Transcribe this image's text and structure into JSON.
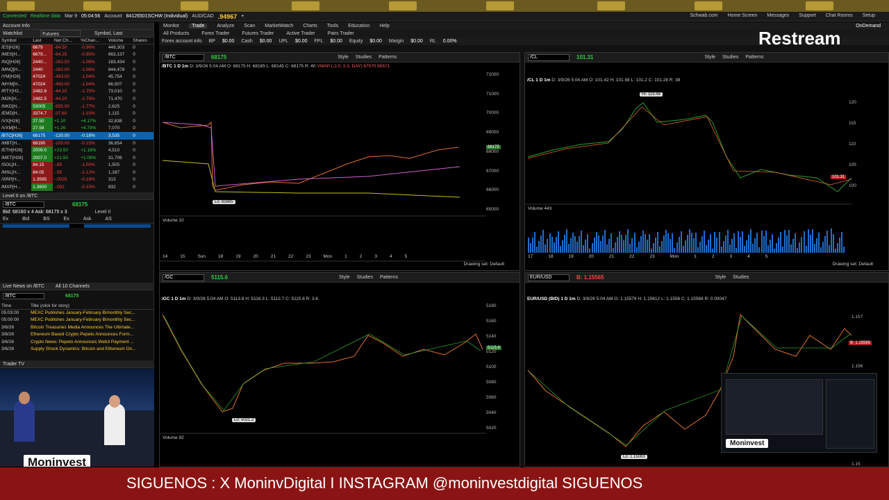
{
  "topbar": {
    "status": "Connected",
    "data": "Realtime data",
    "date": "Mar 9",
    "time": "05:04:56",
    "account_label": "Account",
    "account": "84126501SCHW (Individual)",
    "pair": "AUD/CAD",
    "pair_price": ".94967",
    "links": [
      "Schwab.com",
      "Home Screen",
      "Messages",
      "Support",
      "Chat Rooms",
      "Setup"
    ]
  },
  "left": {
    "account_info": "Account Info",
    "watchlist": "Watchlist",
    "futures": "Futures",
    "symbol_last": "Symbol, Last",
    "columns": [
      "Symbol",
      "Last",
      "Net Ch...",
      "%Chan...",
      "Volume",
      "Shares"
    ],
    "rows": [
      [
        "/ES[H26]",
        "6679",
        "-64.50",
        "-0.96%",
        "449,303",
        "0",
        "dn"
      ],
      [
        "/MES[H...",
        "6679...",
        "-64.25",
        "-0.95%",
        "663,137",
        "0",
        "dn"
      ],
      [
        "/NQ[H26]",
        "2440...",
        "-262.50",
        "-1.06%",
        "183,434",
        "0",
        "dn"
      ],
      [
        "/MNQ[H...",
        "2440",
        "-262.00",
        "-1.06%",
        "844,478",
        "0",
        "dn"
      ],
      [
        "/YM[H26]",
        "47024",
        "-493.00",
        "-1.04%",
        "45,754",
        "0",
        "dn"
      ],
      [
        "/MYM[H...",
        "47024",
        "-493.00",
        "-1.04%",
        "66,907",
        "0",
        "dn"
      ],
      [
        "/RTY[H2...",
        "2482.6",
        "-44.10",
        "-1.75%",
        "73,010",
        "0",
        "dn"
      ],
      [
        "/M2K[H...",
        "2482.5",
        "-44.20",
        "-1.75%",
        "71,470",
        "0",
        "dn"
      ],
      [
        "/NKD[H...",
        "53005",
        "-955.00",
        "-1.77%",
        "2,625",
        "0",
        "up"
      ],
      [
        "/EMD[H...",
        "3374.7",
        "-37.60",
        "-1.10%",
        "1,115",
        "0",
        "dn"
      ],
      [
        "/VX[H26]",
        "27.50",
        "+1.10",
        "+4.17%",
        "32,838",
        "0",
        "up"
      ],
      [
        "/VXM[H...",
        "27.58",
        "+1.26",
        "+4.79%",
        "7,070",
        "0",
        "up"
      ],
      [
        "/BTC[H26]",
        "68175",
        "-120.00",
        "-0.18%",
        "3,535",
        "0",
        "sel"
      ],
      [
        "/MBT[H...",
        "68190",
        "-105.00",
        "-0.15%",
        "36,654",
        "0",
        "dn"
      ],
      [
        "/ETH[H26]",
        "2009.0",
        "+23.50",
        "+1.18%",
        "4,510",
        "0",
        "up"
      ],
      [
        "/MET[H26]",
        "2007.0",
        "+21.50",
        "+1.08%",
        "31,706",
        "0",
        "up"
      ],
      [
        "/SOL[H...",
        "84.15",
        "-.85",
        "-1.00%",
        "1,505",
        "0",
        "dn"
      ],
      [
        "/MSL[H...",
        "84.05",
        "-.95",
        "-1.12%",
        "1,187",
        "0",
        "dn"
      ],
      [
        "/XRP[H...",
        "1.3595",
        "-.0025",
        "-0.18%",
        "313",
        "0",
        "dn"
      ],
      [
        "/MXP[H...",
        "1.3600",
        "-.002",
        "-0.15%",
        "832",
        "0",
        "up"
      ]
    ],
    "level2_title": "Level II on /BTC",
    "level2_sym": "/BTC",
    "level2_price": "68175",
    "bid_ask": "Bid: 68160 x 4   Ask: 68175 x 3",
    "level2_cols": [
      "Ex",
      "Bid",
      "BS",
      "Ex",
      "Ask",
      "AS"
    ],
    "level2_label": "Level II",
    "news_title": "Live News on /BTC",
    "news_channels": "All 10 Channels",
    "news_sym": "/BTC",
    "news_price": "68175",
    "news_cols": [
      "Time",
      "Title (click for story)"
    ],
    "news": [
      [
        "05:03:00",
        "MEXC Publishes January-February Bimonthly Sec..."
      ],
      [
        "05:00:00",
        "MEXC Publishes January-February Bimonthly Sec..."
      ],
      [
        "3/6/26",
        "Bitcoin Treasuries Media Announces The Ultimate..."
      ],
      [
        "3/6/26",
        "Ethereum Based Crypto Pepeto Announces Form..."
      ],
      [
        "3/6/26",
        "Crypto News: Pepeto Announces Web3 Payment ..."
      ],
      [
        "3/6/26",
        "Supply Shock Dynamics: Bitcoin and Ethereum On..."
      ]
    ],
    "trader_tv": "Trader TV",
    "moninvest": "Moninvest"
  },
  "main": {
    "nav": [
      "Monitor",
      "Trade",
      "Analyze",
      "Scan",
      "MarketWatch",
      "Charts",
      "Tools",
      "Education",
      "Help"
    ],
    "subtabs": [
      "All Products",
      "Forex Trader",
      "Futures Trader",
      "Active Trader",
      "Pairs Trader"
    ],
    "account_items": [
      "Forex account info",
      "BP",
      "$0.00",
      "Cash",
      "$0.00",
      "UPL",
      "$0.00",
      "FPL",
      "$0.00",
      "Equity",
      "$0.00",
      "Margin",
      "$0.00",
      "RL",
      "0.00%"
    ],
    "ondemand": "OnDemand"
  },
  "charts": {
    "btc": {
      "sym": "/BTC",
      "price": "68175",
      "head": "/BTC 1 D 1m",
      "info": "D: 3/9/26 5:04 AM  O: 68175  H: 68185  L: 68145  C: 68175  R: 40",
      "study": "VWAP (-2.0, 2.0, DAY)  67070   65571",
      "low": "Lo: 65685",
      "volume": "Volume 10",
      "axis": [
        "72000",
        "71000",
        "70000",
        "69000",
        "68000",
        "67000",
        "66000",
        "65000"
      ],
      "vaxis": [
        "400",
        "200"
      ],
      "xaxis": [
        "14",
        "15",
        "Sun",
        "18",
        "19",
        "20",
        "21",
        "22",
        "23",
        "Mon",
        "1",
        "2",
        "3",
        "4",
        "5"
      ]
    },
    "cl": {
      "sym": "/CL",
      "price": "101.31",
      "head": "/CL 1 D 1m",
      "info": "D: 3/9/26 5:04 AM  O: 101.42  H: 101.58  L: 101.2  C: 101.28  R: 38",
      "high": "Hi: 119.48",
      "volume": "Volume 443",
      "axis": [
        "120",
        "115",
        "110",
        "105",
        "100"
      ],
      "vaxis": [
        "2,000",
        "1,000"
      ],
      "xaxis": [
        "17",
        "18",
        "19",
        "20",
        "21",
        "22",
        "23",
        "Mon",
        "1",
        "2",
        "3",
        "4",
        "5"
      ]
    },
    "gc": {
      "sym": "/GC",
      "price": "5115.6",
      "head": "/GC 1 D 1m",
      "info": "D: 3/9/26 5:04 AM  O: 5113.8  H: 5116.3  L: 5112.7  C: 5115.6  R: 3.6",
      "low": "Lo: 5021.2",
      "volume": "Volume 92",
      "axis": [
        "5180",
        "5160",
        "5140",
        "5120",
        "5100",
        "5080",
        "5060",
        "5040",
        "5020"
      ],
      "vaxis": [
        "750",
        "500",
        "250"
      ]
    },
    "eur": {
      "sym": "EUR/USD",
      "price": "B: 1.15565",
      "head": "EUR/USD (BID) 1 D 1m",
      "info": "D: 3/9/26 5:04 AM  O: 1.15579  H: 1.15612  L: 1.1556  C: 1.15568  R: 0.00047",
      "low": "Lo: 1.15083",
      "axis": [
        "1.157",
        "1.156",
        "1.155",
        "1.15"
      ]
    },
    "toolbar": [
      "Style",
      "Studies",
      "Patterns"
    ],
    "drawing_set": "Drawing set: Default"
  },
  "overlay": {
    "restream": "Restream",
    "moninvest": "Moninvest",
    "ticker": "SIGUENOS :  X  MoninvDigital   I  INSTAGRAM @moninvestdigital                    SIGUENOS"
  }
}
